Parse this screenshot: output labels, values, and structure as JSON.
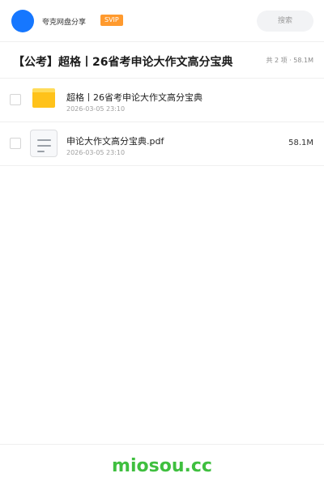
{
  "header": {
    "brand": "夸克网盘分享",
    "badge": "SVIP",
    "search_placeholder": "搜索",
    "accent_color": "#1677ff",
    "badge_color": "#ff9a2e"
  },
  "share": {
    "title": "【公考】超格丨26省考申论大作文高分宝典",
    "summary": "共 2 项 · 58.1M"
  },
  "items": [
    {
      "icon": "folder-icon",
      "name": "超格丨26省考申论大作文高分宝典",
      "date": "2026-03-05 23:10",
      "size": ""
    },
    {
      "icon": "document-icon",
      "name": "申论大作文高分宝典.pdf",
      "date": "2026-03-05 23:10",
      "size": "58.1M"
    }
  ],
  "footer": {
    "watermark": "miosou.cc",
    "watermark_color": "#3fbf3f"
  }
}
